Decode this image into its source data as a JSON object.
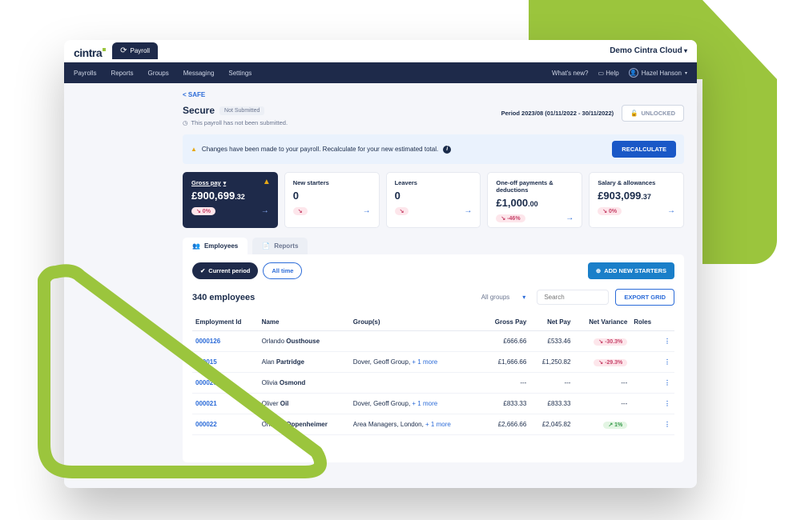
{
  "brand": "cintra",
  "top_tab": "Payroll",
  "tenant": "Demo Cintra Cloud",
  "nav": {
    "items": [
      "Payrolls",
      "Reports",
      "Groups",
      "Messaging",
      "Settings"
    ],
    "whats_new": "What's new?",
    "help": "Help",
    "user": "Hazel Hanson"
  },
  "back_link": "< SAFE",
  "title": "Secure",
  "status_badge": "Not Submitted",
  "sub_note": "This payroll has not been submitted.",
  "period": "Period 2023/08  (01/11/2022 - 30/11/2022)",
  "unlocked": "UNLOCKED",
  "alert_text": "Changes have been made to your payroll. Recalculate for your new estimated total.",
  "recalculate": "RECALCULATE",
  "cards": {
    "gross": {
      "label": "Gross pay",
      "value": "£900,699",
      "dec": ".32",
      "delta": "↘ 0%"
    },
    "starters": {
      "label": "New starters",
      "value": "0",
      "delta": "↘"
    },
    "leavers": {
      "label": "Leavers",
      "value": "0",
      "delta": "↘"
    },
    "oneoff": {
      "label": "One-off payments & deductions",
      "value": "£1,000",
      "dec": ".00",
      "delta": "↘ -46%"
    },
    "salary": {
      "label": "Salary & allowances",
      "value": "£903,099",
      "dec": ".37",
      "delta": "↘ 0%"
    }
  },
  "tabs": {
    "employees": "Employees",
    "reports": "Reports"
  },
  "chips": {
    "current": "Current period",
    "all": "All time"
  },
  "add_starters": "ADD NEW STARTERS",
  "count": "340 employees",
  "filter_groups": "All groups",
  "search_placeholder": "Search",
  "export": "EXPORT GRID",
  "columns": {
    "id": "Employment Id",
    "name": "Name",
    "groups": "Group(s)",
    "gross": "Gross Pay",
    "net": "Net Pay",
    "variance": "Net Variance",
    "roles": "Roles"
  },
  "rows": [
    {
      "id": "0000126",
      "first": "Orlando",
      "last": "Ousthouse",
      "groups": "",
      "gross": "£666.66",
      "net": "£533.46",
      "var": "↘ -30.3%",
      "varclass": "neg"
    },
    {
      "id": "000015",
      "first": "Alan",
      "last": "Partridge",
      "groups": "Dover, Geoff Group,",
      "groups_more": "+ 1 more",
      "gross": "£1,666.66",
      "net": "£1,250.82",
      "var": "↘ -29.3%",
      "varclass": "neg"
    },
    {
      "id": "000020",
      "first": "Olivia",
      "last": "Osmond",
      "groups": "",
      "gross": "---",
      "net": "---",
      "var": "---",
      "varclass": ""
    },
    {
      "id": "000021",
      "first": "Oliver",
      "last": "Oil",
      "groups": "Dover, Geoff Group,",
      "groups_more": "+ 1 more",
      "gross": "£833.33",
      "net": "£833.33",
      "var": "---",
      "varclass": ""
    },
    {
      "id": "000022",
      "first": "Orlando",
      "last": "Oppenheimer",
      "groups": "Area Managers, London,",
      "groups_more": "+ 1 more",
      "gross": "£2,666.66",
      "net": "£2,045.82",
      "var": "↗ 1%",
      "varclass": "pos"
    }
  ]
}
